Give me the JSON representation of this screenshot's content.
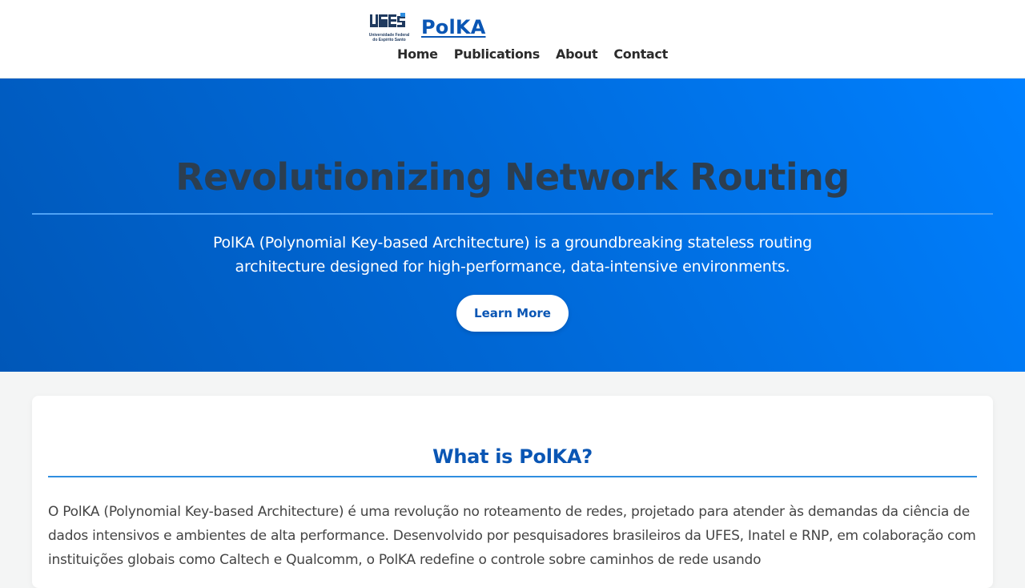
{
  "header": {
    "logo": {
      "icon": "ufes-logo",
      "lines": [
        "UFES",
        "Universidade Federal",
        "do Espírito Santo"
      ]
    },
    "brand_name": "PolKA",
    "nav": [
      {
        "label": "Home"
      },
      {
        "label": "Publications"
      },
      {
        "label": "About"
      },
      {
        "label": "Contact"
      }
    ]
  },
  "hero": {
    "title": "Revolutionizing Network Routing",
    "description": "PolKA (Polynomial Key-based Architecture) is a groundbreaking stateless routing architecture designed for high-performance, data-intensive environments.",
    "cta_label": "Learn More"
  },
  "section": {
    "title": "What is PolKA?",
    "body": "O PolKA (Polynomial Key-based Architecture) é uma revolução no roteamento de redes, projetado para atender às demandas da ciência de dados intensivos e ambientes de alta performance. Desenvolvido por pesquisadores brasileiros da UFES, Inatel e RNP, em colaboração com instituições globais como Caltech e Qualcomm, o PolKA redefine o controle sobre caminhos de rede usando"
  },
  "colors": {
    "brand": "#0a56b4",
    "hero_gradient_start": "#0057b8",
    "hero_gradient_end": "#0080ff",
    "hero_title": "#2c3e50",
    "rule": "#4fa2f5"
  }
}
